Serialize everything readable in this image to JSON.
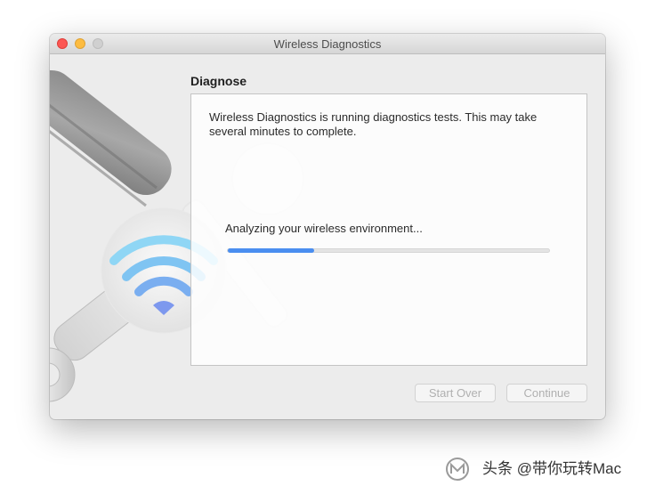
{
  "window": {
    "title": "Wireless Diagnostics"
  },
  "page": {
    "heading": "Diagnose",
    "description": "Wireless Diagnostics is running diagnostics tests. This may take several minutes to complete.",
    "status": "Analyzing your wireless environment...",
    "progress_fraction": 0.27
  },
  "buttons": {
    "start_over": "Start Over",
    "continue": "Continue"
  },
  "watermark": {
    "text": "头条 @带你玩转Mac"
  },
  "colors": {
    "accent": "#4a8ef0",
    "close": "#fc5753",
    "minimize": "#fdbc40",
    "zoom": "#d0d0d0"
  }
}
